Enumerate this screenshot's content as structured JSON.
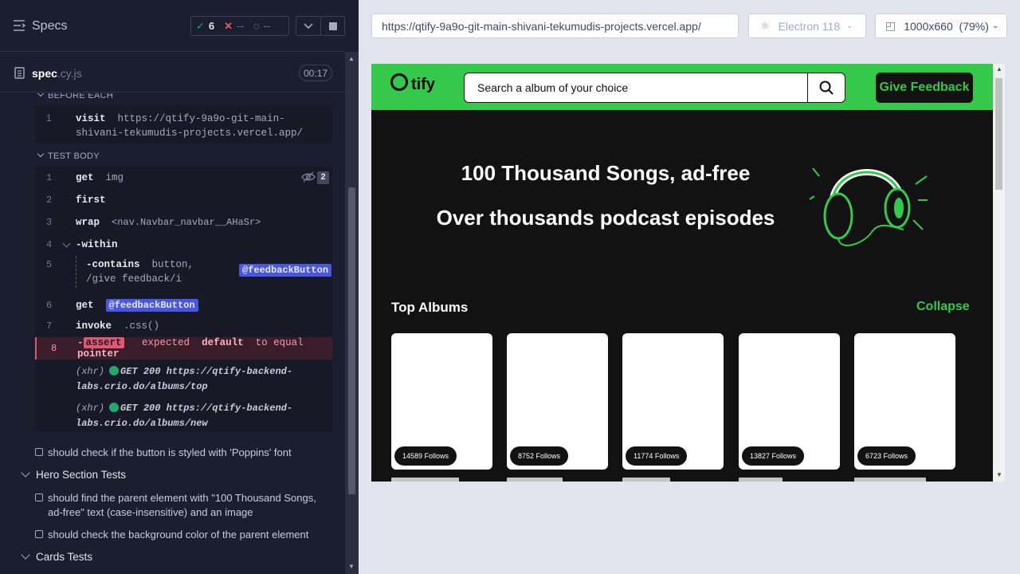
{
  "reporter": {
    "title": "Specs",
    "stats": {
      "passed": "6",
      "failed": "--",
      "pending": "--"
    },
    "spec": {
      "name": "spec",
      "ext": ".cy.js",
      "duration": "00:17"
    },
    "before_each": {
      "heading": "BEFORE EACH",
      "lines": [
        {
          "n": "1",
          "cmd": "visit",
          "arg": "https://qtify-9a9o-git-main-shivani-tekumudis-projects.vercel.app/"
        }
      ]
    },
    "test_body": {
      "heading": "TEST BODY",
      "lines": [
        {
          "n": "1",
          "cmd": "get",
          "arg": "img",
          "count": "2"
        },
        {
          "n": "2",
          "cmd": "first",
          "arg": ""
        },
        {
          "n": "3",
          "cmd": "wrap",
          "arg": "<nav.Navbar_navbar__AHaSr>"
        },
        {
          "n": "4",
          "cmd": "-within",
          "arg": ""
        },
        {
          "n": "5",
          "cmd": "-contains",
          "arg": "button, /give feedback/i",
          "alias": "@feedbackButton"
        },
        {
          "n": "6",
          "cmd": "get",
          "arg": "",
          "alias": "@feedbackButton"
        },
        {
          "n": "7",
          "cmd": "invoke",
          "arg": ".css()"
        },
        {
          "n": "8",
          "cmd": "-assert",
          "arg": "expected default to equal pointer"
        }
      ],
      "assert_parts": [
        "expected",
        "default",
        "to equal",
        "pointer"
      ],
      "xhr": [
        {
          "label": "(xhr)",
          "text": "GET 200 https://qtify-backend-labs.crio.do/albums/top"
        },
        {
          "label": "(xhr)",
          "text": "GET 200 https://qtify-backend-labs.crio.do/albums/new"
        }
      ]
    },
    "tests": [
      "should check if the button is styled with 'Poppins' font",
      "should find the parent element with \"100 Thousand Songs, ad-free\" text (case-insensitive) and an image",
      "should check the background color of the parent element"
    ],
    "suites": [
      "Hero Section Tests",
      "Cards Tests"
    ]
  },
  "browser": {
    "url": "https://qtify-9a9o-git-main-shivani-tekumudis-projects.vercel.app/",
    "browser_name": "Electron 118",
    "viewport": "1000x660",
    "zoom": "(79%)"
  },
  "app": {
    "logo": "tify",
    "search_placeholder": "Search a album of your choice",
    "feedback_label": "Give Feedback",
    "hero_line1": "100 Thousand Songs, ad-free",
    "hero_line2": "Over thousands podcast episodes",
    "albums_title": "Top Albums",
    "collapse_label": "Collapse",
    "cards": [
      {
        "follows": "14589 Follows"
      },
      {
        "follows": "8752 Follows"
      },
      {
        "follows": "11774 Follows"
      },
      {
        "follows": "13827 Follows"
      },
      {
        "follows": "6723 Follows"
      }
    ]
  },
  "colors": {
    "accent_green": "#34c94a",
    "fail_red": "#e45770",
    "alias_blue": "#4956e3",
    "panel_bg": "#1b1e2e"
  }
}
